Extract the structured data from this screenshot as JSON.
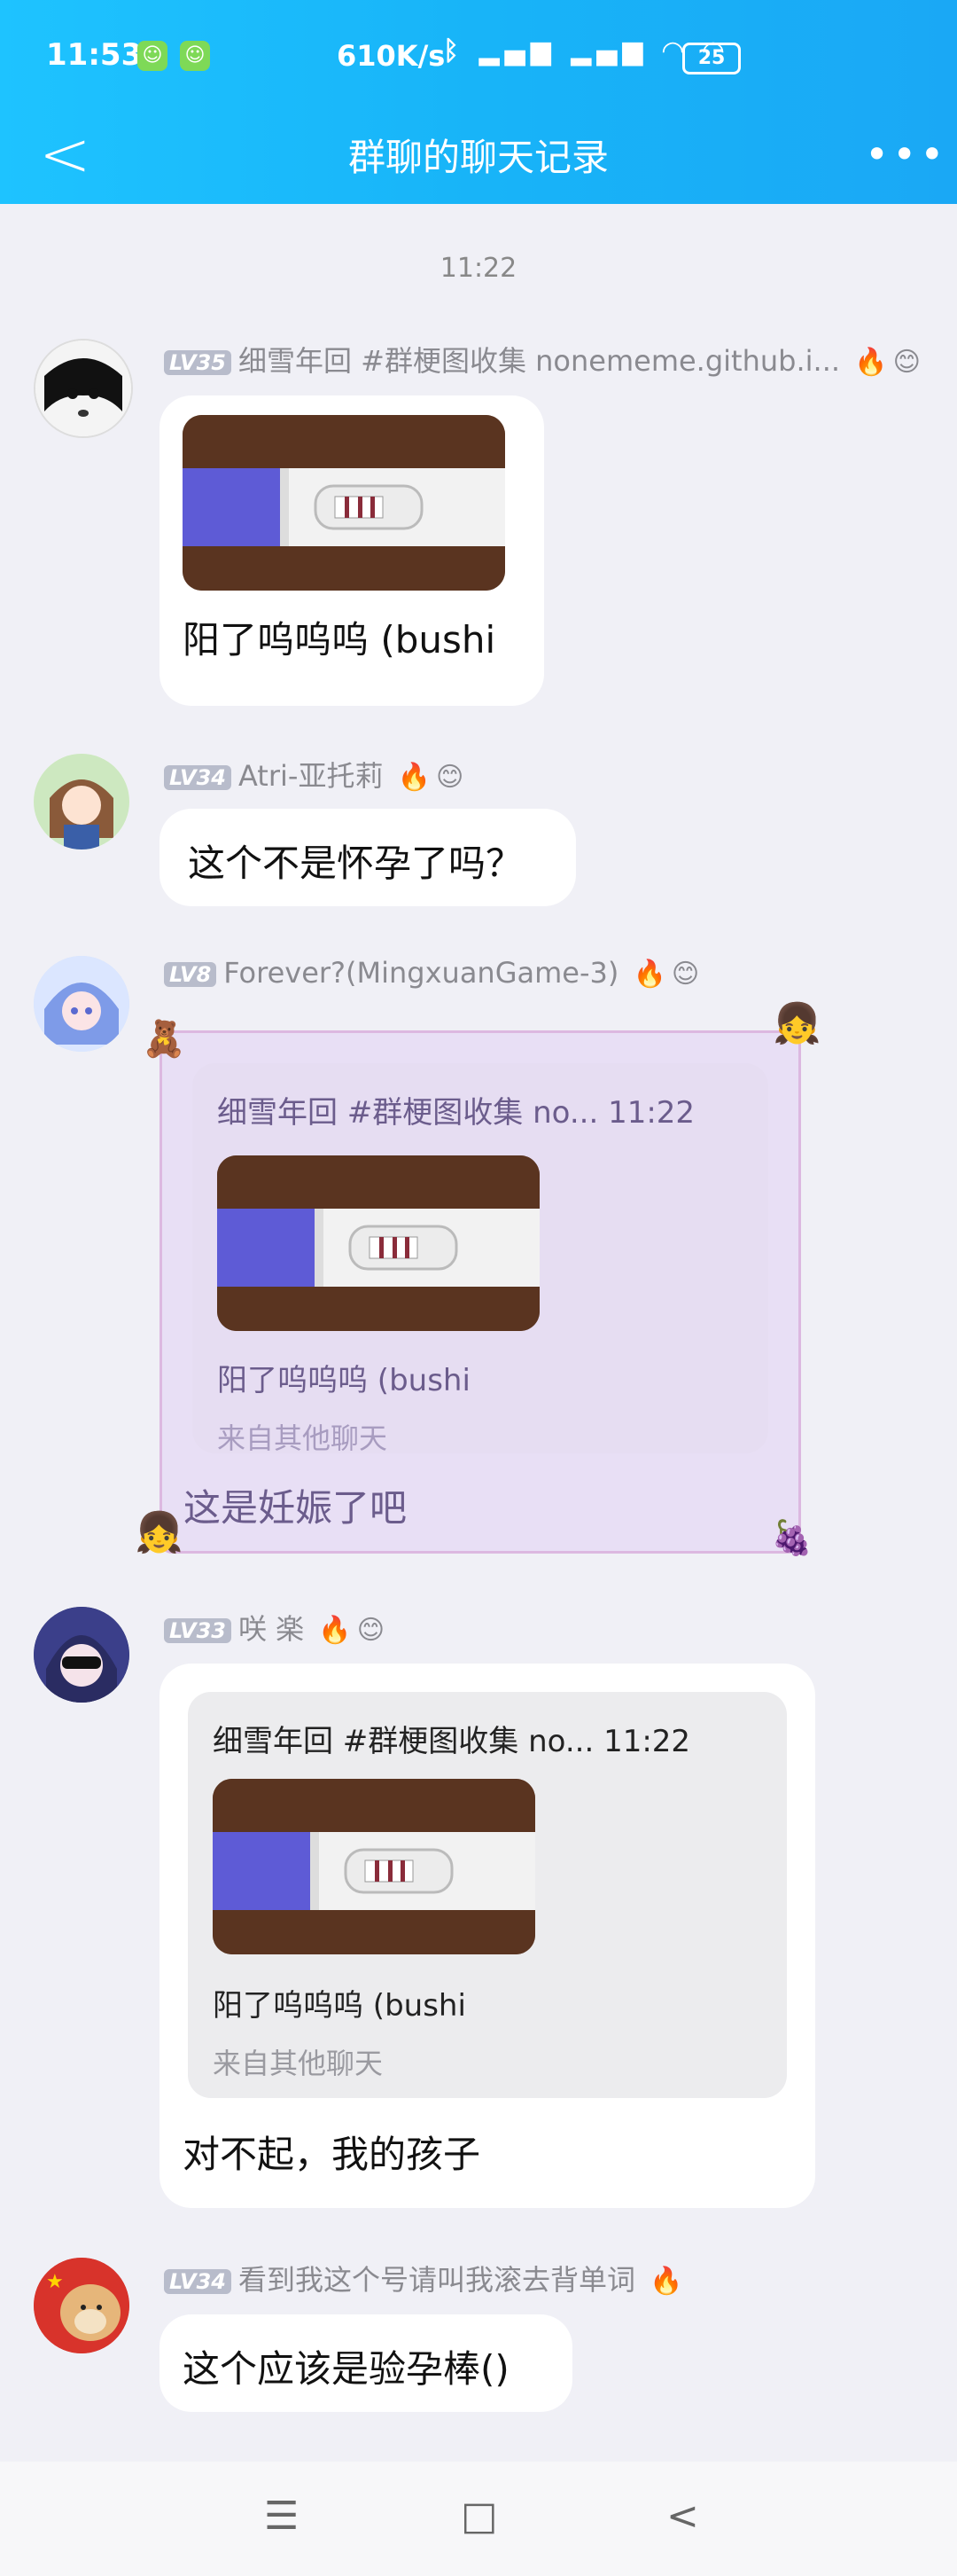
{
  "status_bar": {
    "time": "11:53",
    "speed": "610K/s",
    "battery": "25"
  },
  "nav": {
    "back": "<",
    "title": "群聊的聊天记录",
    "more": "•••"
  },
  "timestamp": "11:22",
  "messages": [
    {
      "level": "LV35",
      "name": "细雪年回 #群梗图收集 nonememe.github.i...",
      "text": "阳了呜呜呜 (bushi"
    },
    {
      "level": "LV34",
      "name": "Atri-亚托莉",
      "text": "这个不是怀孕了吗？"
    },
    {
      "level": "LV8",
      "name": "Forever?(MingxuanGame-3)",
      "quote_head": "细雪年回 #群梗图收集 no... 11:22",
      "quote_text": "阳了呜呜呜 (bushi",
      "quote_src": "来自其他聊天",
      "text": "这是妊娠了吧"
    },
    {
      "level": "LV33",
      "name": "咲 楽",
      "quote_head": "细雪年回 #群梗图收集 no... 11:22",
      "quote_text": "阳了呜呜呜 (bushi",
      "quote_src": "来自其他聊天",
      "text": "对不起，我的孩子"
    },
    {
      "level": "LV34",
      "name": "看到我这个号请叫我滚去背单词",
      "text": "这个应该是验孕棒()"
    }
  ],
  "bottom_nav": {
    "menu": "☰",
    "home": "□",
    "back": "<"
  },
  "colors": {
    "header_start": "#1ec3ff",
    "header_end": "#1aa8f5",
    "background": "#f0f0f6",
    "themed_bubble": "#e8dff5"
  }
}
